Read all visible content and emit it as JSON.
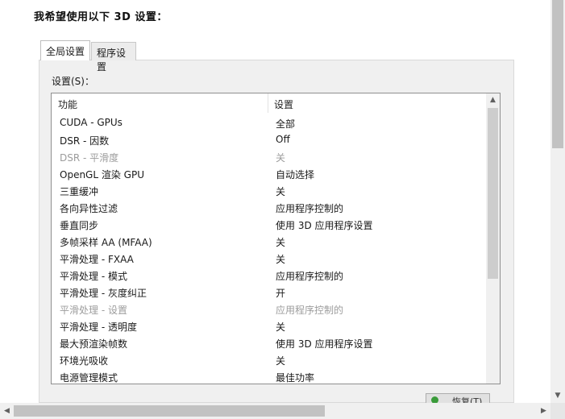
{
  "heading": "我希望使用以下 3D 设置：",
  "tabs": [
    {
      "label": "全局设置"
    },
    {
      "label": "程序设置"
    }
  ],
  "settings_label": "设置(S)：",
  "table": {
    "columns": [
      "功能",
      "设置"
    ],
    "rows": [
      {
        "feature": "CUDA - GPUs",
        "value": "全部"
      },
      {
        "feature": "DSR - 因数",
        "value": "Off"
      },
      {
        "feature": "DSR - 平滑度",
        "value": "关"
      },
      {
        "feature": "OpenGL 渲染 GPU",
        "value": "自动选择"
      },
      {
        "feature": "三重缓冲",
        "value": "关"
      },
      {
        "feature": "各向异性过滤",
        "value": "应用程序控制的"
      },
      {
        "feature": "垂直同步",
        "value": "使用 3D 应用程序设置"
      },
      {
        "feature": "多帧采样 AA (MFAA)",
        "value": "关"
      },
      {
        "feature": "平滑处理 - FXAA",
        "value": "关"
      },
      {
        "feature": "平滑处理 - 模式",
        "value": "应用程序控制的"
      },
      {
        "feature": "平滑处理 - 灰度纠正",
        "value": "开"
      },
      {
        "feature": "平滑处理 - 设置",
        "value": "应用程序控制的"
      },
      {
        "feature": "平滑处理 - 透明度",
        "value": "关"
      },
      {
        "feature": "最大预渲染帧数",
        "value": "使用 3D 应用程序设置"
      },
      {
        "feature": "环境光吸收",
        "value": "关"
      },
      {
        "feature": "电源管理模式",
        "value": "最佳功率"
      }
    ]
  },
  "restore_button": "恢复(T)",
  "icons": {
    "scroll_up": "scroll-up-arrow-icon",
    "scroll_down": "scroll-down-arrow-icon",
    "scroll_left": "scroll-left-arrow-icon",
    "scroll_right": "scroll-right-arrow-icon"
  }
}
